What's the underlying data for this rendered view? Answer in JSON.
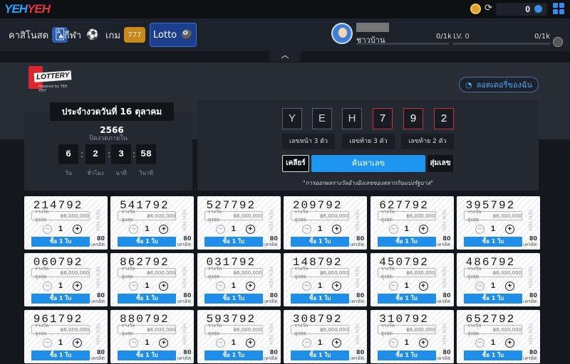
{
  "brand": {
    "part1": "YEH",
    "part2": "YEH"
  },
  "topbar": {
    "balance": "0"
  },
  "nav": [
    {
      "label": "คาสิโนสด",
      "icon": "cards-icon"
    },
    {
      "label": "กีฬา",
      "icon": "soccer-ball-icon"
    },
    {
      "label": "เกม",
      "icon": "slot-machine-icon"
    },
    {
      "label": "Lotto",
      "icon": "lottery-balls-icon"
    }
  ],
  "profile": {
    "rank": "ชาวบ้าน",
    "xp_left": "0/1k",
    "level": "LV. 0",
    "xp_right": "0/1k"
  },
  "lottery_logo": {
    "text": "LOTTERY",
    "powered": "Powered by YEH YEH"
  },
  "my_lottery_label": "ลอตเตอรี่ของฉัน",
  "draw": {
    "date_label": "ประจำงวดวันที่ 16 ตุลาคม 2566",
    "closes_label": "ปิดงวดภายใน",
    "countdown": [
      {
        "value": "6",
        "label": "วัน"
      },
      {
        "value": "2",
        "label": "ชั่วโมง"
      },
      {
        "value": "3",
        "label": "นาที"
      },
      {
        "value": "58",
        "label": "วินาที"
      }
    ]
  },
  "search": {
    "digits": [
      "Y",
      "E",
      "H",
      "7",
      "9",
      "2"
    ],
    "options": [
      "เลขหน้า 3 ตัว",
      "เลขท้าย 3 ตัว",
      "เลขท้าย 2 ตัว"
    ],
    "clear": "เคลียร์",
    "search": "ค้นหาเลข",
    "random": "สุ่มเลข",
    "disclaimer": "\"การออกผลรางวัลอ้างอิงเลขของสลากกินแบ่งรัฐบาล\""
  },
  "ticket_common": {
    "prize_label": "รางวัลสูงสุด",
    "prize_value": "฿6,000,000",
    "qty": "1",
    "minus": "−",
    "plus": "+",
    "buy": "ซื้อ 1 ใบ",
    "credits": "80",
    "credits_unit": "เครดิต",
    "stub": "YEH YEH"
  },
  "tickets": [
    "214792",
    "541792",
    "527792",
    "209792",
    "627792",
    "395792",
    "060792",
    "862792",
    "031792",
    "148792",
    "450792",
    "486792",
    "961792",
    "880792",
    "593792",
    "308792",
    "310792",
    "652792"
  ]
}
